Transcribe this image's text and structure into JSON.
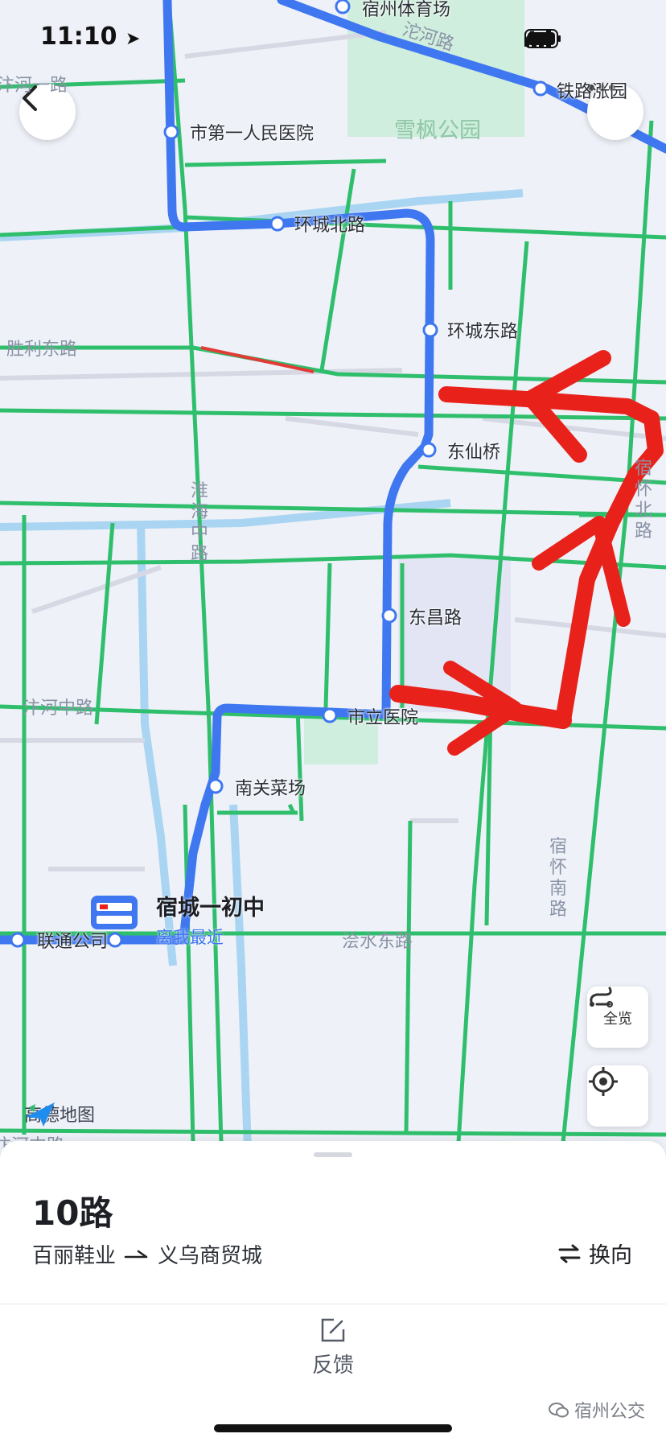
{
  "status_bar": {
    "time": "11:10",
    "signal": "4"
  },
  "map": {
    "places": {
      "hospital_1": "市第一人民医院",
      "park": "雪枫公园",
      "stadium": "宿州体育场",
      "railway_stop": "铁路涨园"
    },
    "roads": {
      "bianhe_road": "沱河路",
      "shengli_east": "胜利东路",
      "huaihai_middle": "淮海中路",
      "bianhe_middle": "汴河中路",
      "suhuai_south": "宿怀南路",
      "kuaishui_east": "浍水东路",
      "suhuai_north": "宿怀北路",
      "top_left_partial": "汴河一路",
      "bottom_left_partial": "汴河中路"
    },
    "stops": [
      {
        "name": "环城北路"
      },
      {
        "name": "环城东路"
      },
      {
        "name": "东仙桥"
      },
      {
        "name": "东昌路"
      },
      {
        "name": "市立医院"
      },
      {
        "name": "南关菜场"
      },
      {
        "name": "联通公司"
      }
    ],
    "nearest_stop": {
      "name": "宿城一初中",
      "tag": "离我最近"
    },
    "logo": "高德地图",
    "buttons": {
      "overview": "全览"
    },
    "colors": {
      "route": "#3f77f0",
      "road": "#2fbf6c",
      "annotation": "#e8221b",
      "park": "#cfeedd"
    }
  },
  "sheet": {
    "route_name": "10路",
    "from": "百丽鞋业",
    "to": "义乌商贸城",
    "switch_label": "换向",
    "feedback_label": "反馈",
    "watermark": "宿州公交"
  }
}
